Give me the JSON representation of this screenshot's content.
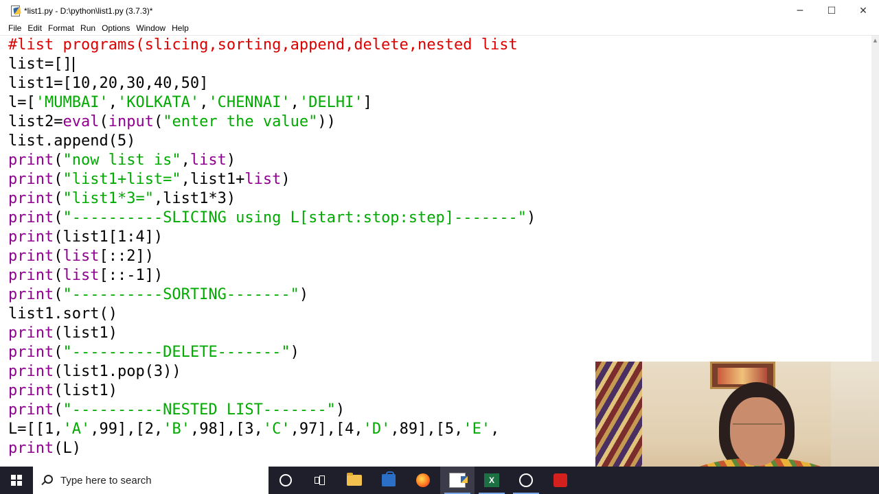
{
  "window": {
    "title": "*list1.py - D:\\python\\list1.py (3.7.3)*",
    "controls": {
      "minimize": "─",
      "maximize": "☐",
      "close": "✕"
    }
  },
  "menu": {
    "items": [
      "File",
      "Edit",
      "Format",
      "Run",
      "Options",
      "Window",
      "Help"
    ]
  },
  "editor": {
    "lines": [
      [
        {
          "t": "#list programs(slicing,sorting,append,delete,nested list",
          "c": "cm"
        }
      ],
      [
        {
          "t": "list=[]",
          "c": ""
        }
      ],
      [
        {
          "t": "list1=[10,20,30,40,50]",
          "c": ""
        }
      ],
      [
        {
          "t": "l=[",
          "c": ""
        },
        {
          "t": "'MUMBAI'",
          "c": "st"
        },
        {
          "t": ",",
          "c": ""
        },
        {
          "t": "'KOLKATA'",
          "c": "st"
        },
        {
          "t": ",",
          "c": ""
        },
        {
          "t": "'CHENNAI'",
          "c": "st"
        },
        {
          "t": ",",
          "c": ""
        },
        {
          "t": "'DELHI'",
          "c": "st"
        },
        {
          "t": "]",
          "c": ""
        }
      ],
      [
        {
          "t": "list2=",
          "c": ""
        },
        {
          "t": "eval",
          "c": "kw"
        },
        {
          "t": "(",
          "c": ""
        },
        {
          "t": "input",
          "c": "kw"
        },
        {
          "t": "(",
          "c": ""
        },
        {
          "t": "\"enter the value\"",
          "c": "st"
        },
        {
          "t": "))",
          "c": ""
        }
      ],
      [
        {
          "t": "list.append(5)",
          "c": ""
        }
      ],
      [
        {
          "t": "print",
          "c": "kw"
        },
        {
          "t": "(",
          "c": ""
        },
        {
          "t": "\"now list is\"",
          "c": "st"
        },
        {
          "t": ",",
          "c": ""
        },
        {
          "t": "list",
          "c": "kw"
        },
        {
          "t": ")",
          "c": ""
        }
      ],
      [
        {
          "t": "print",
          "c": "kw"
        },
        {
          "t": "(",
          "c": ""
        },
        {
          "t": "\"list1+list=\"",
          "c": "st"
        },
        {
          "t": ",list1+",
          "c": ""
        },
        {
          "t": "list",
          "c": "kw"
        },
        {
          "t": ")",
          "c": ""
        }
      ],
      [
        {
          "t": "print",
          "c": "kw"
        },
        {
          "t": "(",
          "c": ""
        },
        {
          "t": "\"list1*3=\"",
          "c": "st"
        },
        {
          "t": ",list1*3)",
          "c": ""
        }
      ],
      [
        {
          "t": "print",
          "c": "kw"
        },
        {
          "t": "(",
          "c": ""
        },
        {
          "t": "\"----------SLICING using L[start:stop:step]-------\"",
          "c": "st"
        },
        {
          "t": ")",
          "c": ""
        }
      ],
      [
        {
          "t": "print",
          "c": "kw"
        },
        {
          "t": "(list1[1:4])",
          "c": ""
        }
      ],
      [
        {
          "t": "print",
          "c": "kw"
        },
        {
          "t": "(",
          "c": ""
        },
        {
          "t": "list",
          "c": "kw"
        },
        {
          "t": "[::2])",
          "c": ""
        }
      ],
      [
        {
          "t": "print",
          "c": "kw"
        },
        {
          "t": "(",
          "c": ""
        },
        {
          "t": "list",
          "c": "kw"
        },
        {
          "t": "[::-1])",
          "c": ""
        }
      ],
      [
        {
          "t": "print",
          "c": "kw"
        },
        {
          "t": "(",
          "c": ""
        },
        {
          "t": "\"----------SORTING-------\"",
          "c": "st"
        },
        {
          "t": ")",
          "c": ""
        }
      ],
      [
        {
          "t": "list1.sort()",
          "c": ""
        }
      ],
      [
        {
          "t": "print",
          "c": "kw"
        },
        {
          "t": "(list1)",
          "c": ""
        }
      ],
      [
        {
          "t": "print",
          "c": "kw"
        },
        {
          "t": "(",
          "c": ""
        },
        {
          "t": "\"----------DELETE-------\"",
          "c": "st"
        },
        {
          "t": ")",
          "c": ""
        }
      ],
      [
        {
          "t": "print",
          "c": "kw"
        },
        {
          "t": "(list1.pop(3))",
          "c": ""
        }
      ],
      [
        {
          "t": "print",
          "c": "kw"
        },
        {
          "t": "(list1)",
          "c": ""
        }
      ],
      [
        {
          "t": "print",
          "c": "kw"
        },
        {
          "t": "(",
          "c": ""
        },
        {
          "t": "\"----------NESTED LIST-------\"",
          "c": "st"
        },
        {
          "t": ")",
          "c": ""
        }
      ],
      [
        {
          "t": "L=[[1,",
          "c": ""
        },
        {
          "t": "'A'",
          "c": "st"
        },
        {
          "t": ",99],[2,",
          "c": ""
        },
        {
          "t": "'B'",
          "c": "st"
        },
        {
          "t": ",98],[3,",
          "c": ""
        },
        {
          "t": "'C'",
          "c": "st"
        },
        {
          "t": ",97],[4,",
          "c": ""
        },
        {
          "t": "'D'",
          "c": "st"
        },
        {
          "t": ",89],[5,",
          "c": ""
        },
        {
          "t": "'E'",
          "c": "st"
        },
        {
          "t": ",",
          "c": ""
        }
      ],
      [
        {
          "t": "print",
          "c": "kw"
        },
        {
          "t": "(L)",
          "c": ""
        }
      ]
    ],
    "cursor_line": 1
  },
  "taskbar": {
    "search_placeholder": "Type here to search",
    "excel_letter": "X"
  },
  "colors": {
    "comment": "#dd0000",
    "builtin": "#900090",
    "string": "#00aa00",
    "taskbar": "#1f1f2b"
  }
}
